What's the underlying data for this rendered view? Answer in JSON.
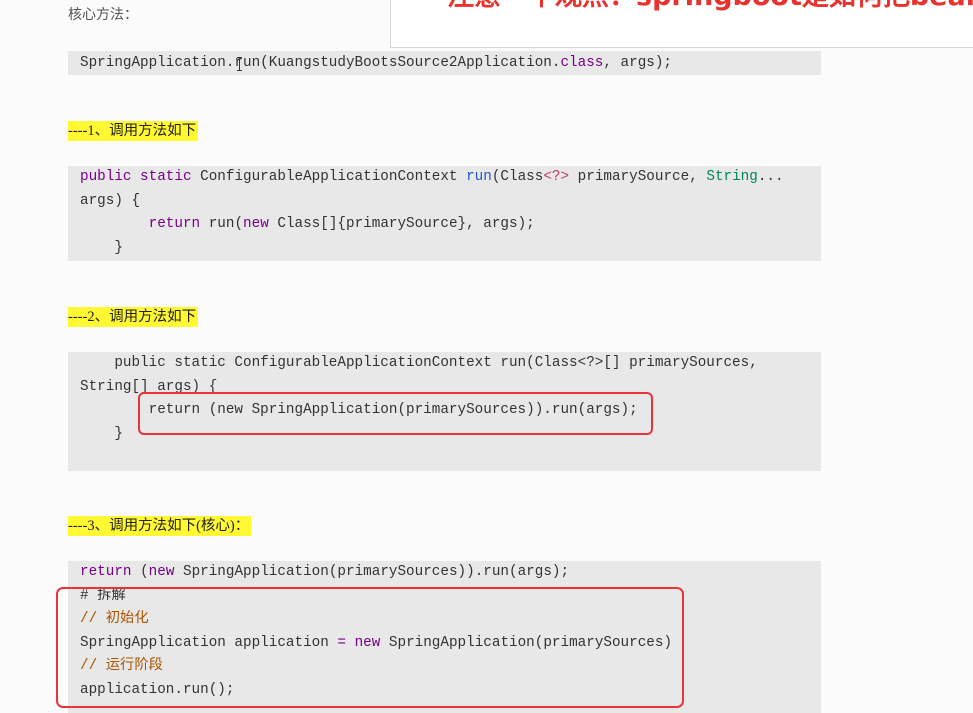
{
  "page": {
    "intro_label": "核心方法："
  },
  "overlay": {
    "headline": "注意一个观点：springboot是如何把bean"
  },
  "colors": {
    "highlight": "#fff833",
    "annotation": "#e8353a",
    "code_background": "#e8e8e8",
    "popup_text": "#e8322f"
  },
  "sections": [
    {
      "heading": "----1、调用方法如下"
    },
    {
      "heading": "----2、调用方法如下"
    },
    {
      "heading": "----3、调用方法如下(核心)："
    }
  ],
  "code_blocks": [
    {
      "lines": [
        [
          {
            "t": "SpringApplication.run(KuangstudyBootsSource2Application."
          },
          {
            "t": "class",
            "color": "#770088"
          },
          {
            "t": ", args);"
          }
        ]
      ]
    },
    {
      "lines": [
        [
          {
            "t": "public static",
            "color": "#770088"
          },
          {
            "t": " ConfigurableApplicationContext "
          },
          {
            "t": "run",
            "color": "#2456c9"
          },
          {
            "t": "(Class"
          },
          {
            "t": "<?>",
            "color": "#b8406a"
          },
          {
            "t": " primarySource, "
          },
          {
            "t": "String",
            "color": "#008855"
          },
          {
            "t": "..."
          }
        ],
        [
          {
            "t": "args) {"
          }
        ],
        [
          {
            "t": "        "
          },
          {
            "t": "return",
            "color": "#770088"
          },
          {
            "t": " run("
          },
          {
            "t": "new",
            "color": "#770088"
          },
          {
            "t": " Class[]{primarySource}, args);"
          }
        ],
        [
          {
            "t": "    }"
          }
        ]
      ]
    },
    {
      "lines": [
        [
          {
            "t": "    public static ConfigurableApplicationContext run(Class<?>[] primarySources,"
          }
        ],
        [
          {
            "t": "String[] args) {"
          }
        ],
        [
          {
            "t": "        return (new SpringApplication(primarySources)).run(args);"
          }
        ],
        [
          {
            "t": "    }"
          }
        ],
        []
      ]
    },
    {
      "lines": [
        [
          {
            "t": "return",
            "color": "#770088"
          },
          {
            "t": " ("
          },
          {
            "t": "new",
            "color": "#770088"
          },
          {
            "t": " SpringApplication(primarySources)).run(args);"
          }
        ],
        [
          {
            "t": "# 拆解"
          }
        ],
        [
          {
            "t": "// 初始化",
            "color": "#aa5500"
          }
        ],
        [
          {
            "t": "SpringApplication application "
          },
          {
            "t": "=",
            "color": "#770088"
          },
          {
            "t": " "
          },
          {
            "t": "new",
            "color": "#770088"
          },
          {
            "t": " SpringApplication(primarySources)"
          }
        ],
        [
          {
            "t": "// 运行阶段",
            "color": "#aa5500"
          }
        ],
        [
          {
            "t": "application.run();"
          }
        ]
      ]
    }
  ]
}
